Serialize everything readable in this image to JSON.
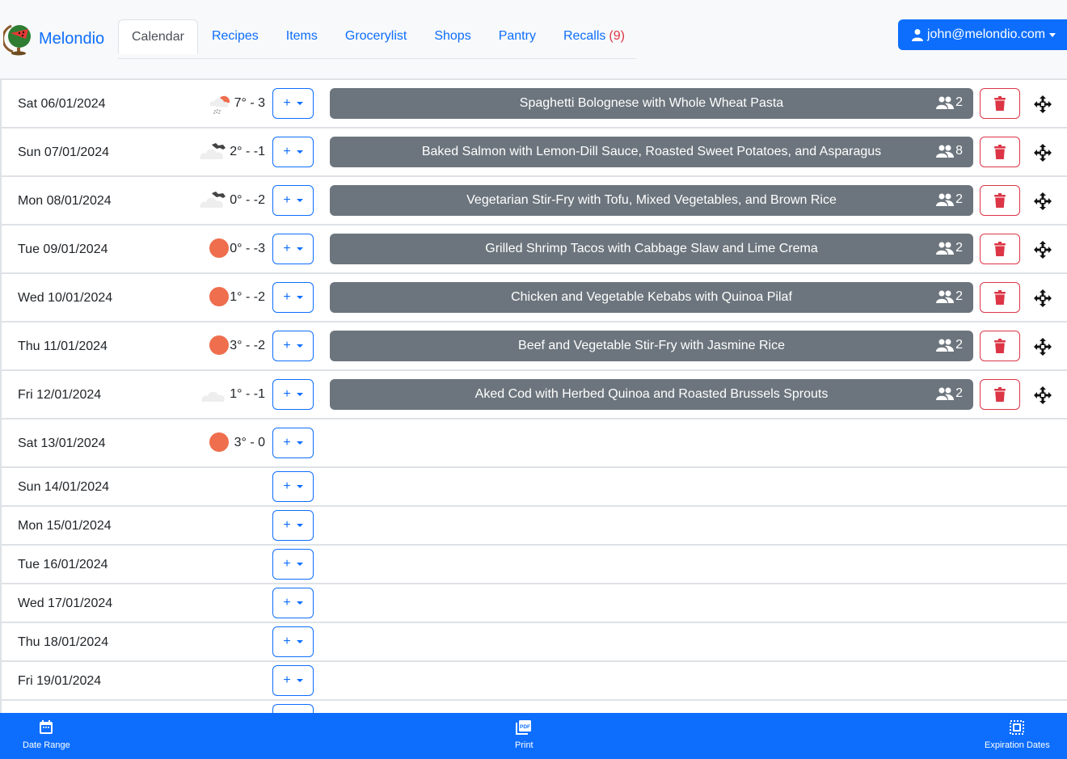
{
  "app": {
    "brand": "Melondio",
    "colors": {
      "primary": "#0d6efd",
      "secondary": "#6c757d",
      "danger": "#dc3545",
      "sun": "#ee6e4d"
    }
  },
  "nav": {
    "tabs": [
      {
        "label": "Calendar",
        "active": true
      },
      {
        "label": "Recipes"
      },
      {
        "label": "Items"
      },
      {
        "label": "Grocerylist"
      },
      {
        "label": "Shops"
      },
      {
        "label": "Pantry"
      },
      {
        "label": "Recalls",
        "badge": "(9)"
      }
    ]
  },
  "user": {
    "email": "john@melondio.com",
    "icon": "user-icon"
  },
  "days": [
    {
      "date": "Sat 06/01/2024",
      "weather": "rain-partly-sunny",
      "temp": "7° - 3",
      "add": "+",
      "meal": "Spaghetti Bolognese with Whole Wheat Pasta",
      "persons": "2"
    },
    {
      "date": "Sun 07/01/2024",
      "weather": "cloud-storm",
      "temp": "2° - -1",
      "add": "+",
      "meal": "Baked Salmon with Lemon-Dill Sauce, Roasted Sweet Potatoes, and Asparagus",
      "persons": "8"
    },
    {
      "date": "Mon 08/01/2024",
      "weather": "cloud-storm",
      "temp": "0° - -2",
      "add": "+",
      "meal": "Vegetarian Stir-Fry with Tofu, Mixed Vegetables, and Brown Rice",
      "persons": "2"
    },
    {
      "date": "Tue 09/01/2024",
      "weather": "sun",
      "temp": "0° - -3",
      "add": "+",
      "meal": "Grilled Shrimp Tacos with Cabbage Slaw and Lime Crema",
      "persons": "2"
    },
    {
      "date": "Wed 10/01/2024",
      "weather": "sun",
      "temp": "1° - -2",
      "add": "+",
      "meal": "Chicken and Vegetable Kebabs with Quinoa Pilaf",
      "persons": "2"
    },
    {
      "date": "Thu 11/01/2024",
      "weather": "sun",
      "temp": "3° - -2",
      "add": "+",
      "meal": "Beef and Vegetable Stir-Fry with Jasmine Rice",
      "persons": "2"
    },
    {
      "date": "Fri 12/01/2024",
      "weather": "cloud",
      "temp": "1° - -1",
      "add": "+",
      "meal": "Aked Cod with Herbed Quinoa and Roasted Brussels Sprouts",
      "persons": "2"
    },
    {
      "date": "Sat 13/01/2024",
      "weather": "sun",
      "temp": "3° - 0",
      "add": "+"
    },
    {
      "date": "Sun 14/01/2024",
      "add": "+"
    },
    {
      "date": "Mon 15/01/2024",
      "add": "+"
    },
    {
      "date": "Tue 16/01/2024",
      "add": "+"
    },
    {
      "date": "Wed 17/01/2024",
      "add": "+"
    },
    {
      "date": "Thu 18/01/2024",
      "add": "+"
    },
    {
      "date": "Fri 19/01/2024",
      "add": "+"
    },
    {
      "date": "",
      "add": "+"
    }
  ],
  "bottombar": {
    "items": [
      {
        "label": "Date Range",
        "icon": "calendar-icon"
      },
      {
        "label": "Print",
        "icon": "pdf-icon"
      },
      {
        "label": "Expiration Dates",
        "icon": "dashed-square-icon"
      }
    ]
  }
}
